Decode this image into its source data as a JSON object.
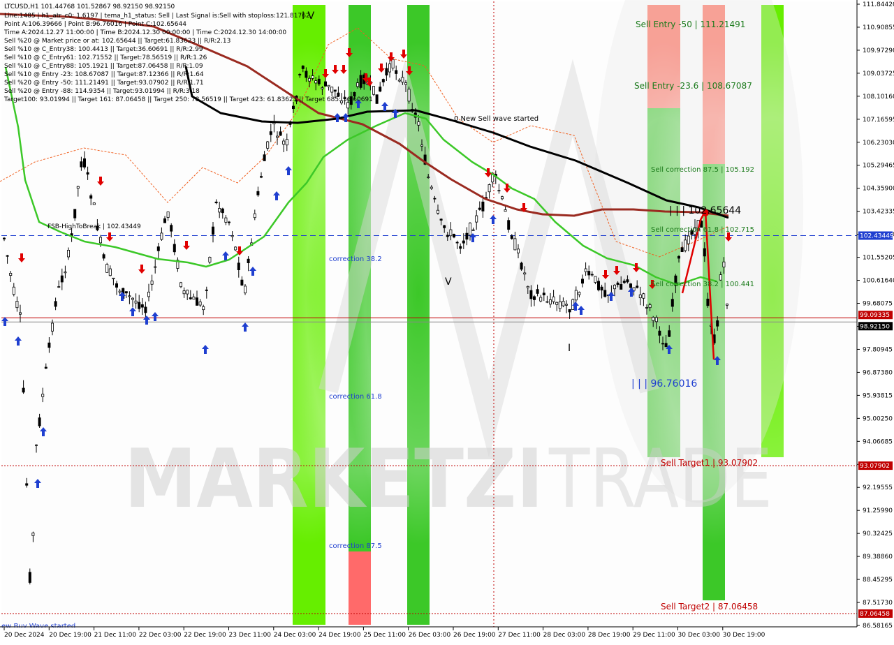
{
  "chart_data": {
    "type": "candlestick",
    "symbol_line": "LTCUSD,H1  101.44768 101.52867 98.92150 98.92150",
    "info_lines": [
      "Line:1485 | h1_atr_c0: 1.6197 | tema_h1_status: Sell | Last Signal is:Sell with stoploss:121.81762",
      "Point A:106.39666 | Point B:96.76016 | Point C:102.65644",
      "Time A:2024.12.27 11:00:00 | Time B:2024.12.30 00:00:00 | Time C:2024.12.30 14:00:00",
      "Sell %20 @ Market price or at: 102.65644 || Target:61.83623 || R/R:2.13",
      "Sell %10 @ C_Entry38: 100.4413 || Target:36.60691 || R/R:2.99",
      "Sell %10 @ C_Entry61: 102.71552 || Target:78.56519 || R/R:1.26",
      "Sell %10 @ C_Entry88: 105.1921 || Target:87.06458 || R/R:1.09",
      "Sell %10 @ Entry -23: 108.67087 || Target:87.12366 || R/R:1.64",
      "Sell %20 @ Entry -50: 111.21491 || Target:93.07902 || R/R:1.71",
      "Sell %20 @ Entry -88: 114.9354 || Target:93.01994 || R/R:3.18",
      "Target100: 93.01994 || Target 161: 87.06458 || Target 250: 78.56519 || Target 423: 61.83623 || Target 685: 36.60691"
    ],
    "y_ticks": [
      "111.84420",
      "110.90855",
      "109.97290",
      "109.03725",
      "108.10160",
      "107.16595",
      "106.23030",
      "105.29465",
      "104.35900",
      "103.42335",
      "102.48770",
      "101.55205",
      "100.61640",
      "99.68075",
      "98.74510",
      "97.80945",
      "96.87380",
      "95.93815",
      "95.00250",
      "94.06685",
      "93.13120",
      "92.19555",
      "91.25990",
      "90.32425",
      "89.38860",
      "88.45295",
      "87.51730",
      "86.58165"
    ],
    "y_range": [
      86.58165,
      111.8442
    ],
    "x_ticks": [
      "20 Dec 2024",
      "20 Dec 19:00",
      "21 Dec 11:00",
      "22 Dec 03:00",
      "22 Dec 19:00",
      "23 Dec 11:00",
      "24 Dec 03:00",
      "24 Dec 19:00",
      "25 Dec 11:00",
      "26 Dec 03:00",
      "26 Dec 19:00",
      "27 Dec 11:00",
      "28 Dec 03:00",
      "28 Dec 19:00",
      "29 Dec 11:00",
      "30 Dec 03:00",
      "30 Dec 19:00"
    ],
    "price_badges": [
      {
        "value": "102.43449",
        "price": 102.43449,
        "bg": "#1f3fd0",
        "fg": "#ffffff"
      },
      {
        "value": "99.09335",
        "price": 99.09335,
        "bg": "#c00000",
        "fg": "#ffffff"
      },
      {
        "value": "98.92150",
        "price": 98.9215,
        "bg": "#000000",
        "fg": "#ffffff"
      },
      {
        "value": "93.07902",
        "price": 93.07902,
        "bg": "#c00000",
        "fg": "#ffffff"
      },
      {
        "value": "87.06458",
        "price": 87.06458,
        "bg": "#c00000",
        "fg": "#ffffff"
      }
    ],
    "horizontal_lines": [
      {
        "price": 102.43449,
        "color": "#1f3fd0",
        "style": "dashed"
      },
      {
        "price": 99.09335,
        "color": "#c00000",
        "style": "solid"
      },
      {
        "price": 98.9215,
        "color": "#888888",
        "style": "solid"
      },
      {
        "price": 93.07902,
        "color": "#c00000",
        "style": "dotted"
      },
      {
        "price": 87.06458,
        "color": "#c00000",
        "style": "dotted"
      }
    ],
    "labels": {
      "fsb": "FSB-HighToBreak | 102.43449",
      "corr382": "correction 38.2",
      "corr618": "correction 61.8",
      "corr875": "correction 87.5",
      "new_wave": "0 New Sell wave started",
      "sell_entry_50": "Sell Entry -50 | 111.21491",
      "sell_entry_236": "Sell Entry -23.6 | 108.67087",
      "sell_corr_875": "Sell correction 87.5 | 105.192",
      "sell_corr_618": "Sell correction 61.8 | 102.715",
      "sell_corr_382": "Sell correction 38.2 | 100.441",
      "point_c": "| | | 102.65644",
      "point_b": "| | | 96.76016",
      "target1": "Sell Target1 | 93.07902",
      "target2": "Sell Target2 | 87.06458",
      "wave_iv": "I V",
      "wave_v": "V",
      "wave_i": "I",
      "buy_wave": "ew Buy Wave started",
      "watermark_a": "MARKETZI",
      "watermark_b": "TRADE"
    },
    "zones": [
      {
        "start": 419,
        "end": 466,
        "bands": [
          {
            "from": 7,
            "to": 895,
            "color": "#66ee00"
          }
        ]
      },
      {
        "start": 499,
        "end": 531,
        "bands": [
          {
            "from": 7,
            "to": 790,
            "color": "#3cc828"
          },
          {
            "from": 790,
            "to": 895,
            "color": "#ff6a6a"
          }
        ]
      },
      {
        "start": 583,
        "end": 615,
        "bands": [
          {
            "from": 7,
            "to": 895,
            "color": "#3cc828"
          }
        ]
      },
      {
        "start": 927,
        "end": 974,
        "bands": [
          {
            "from": 7,
            "to": 155,
            "color": "#ff7b6b"
          },
          {
            "from": 155,
            "to": 655,
            "color": "#3cc828"
          }
        ]
      },
      {
        "start": 1006,
        "end": 1038,
        "bands": [
          {
            "from": 7,
            "to": 235,
            "color": "#ff7b6b"
          },
          {
            "from": 235,
            "to": 860,
            "color": "#3cc828"
          }
        ]
      },
      {
        "start": 1090,
        "end": 1122,
        "bands": [
          {
            "from": 7,
            "to": 655,
            "color": "#66ee00"
          }
        ]
      }
    ],
    "ma_black": [
      [
        266,
        95
      ],
      [
        275,
        138
      ],
      [
        316,
        162
      ],
      [
        375,
        174
      ],
      [
        426,
        176
      ],
      [
        483,
        170
      ],
      [
        526,
        160
      ],
      [
        595,
        158
      ],
      [
        646,
        172
      ],
      [
        706,
        190
      ],
      [
        759,
        210
      ],
      [
        824,
        230
      ],
      [
        899,
        262
      ],
      [
        954,
        287
      ],
      [
        1000,
        297
      ],
      [
        1043,
        312
      ]
    ],
    "ma_darkred": [
      [
        0,
        20
      ],
      [
        96,
        24
      ],
      [
        162,
        30
      ],
      [
        220,
        38
      ],
      [
        289,
        67
      ],
      [
        354,
        95
      ],
      [
        415,
        135
      ],
      [
        456,
        162
      ],
      [
        519,
        178
      ],
      [
        572,
        206
      ],
      [
        605,
        230
      ],
      [
        646,
        257
      ],
      [
        695,
        285
      ],
      [
        740,
        300
      ],
      [
        777,
        307
      ],
      [
        822,
        309
      ],
      [
        862,
        300
      ],
      [
        907,
        300
      ],
      [
        952,
        303
      ],
      [
        1000,
        304
      ],
      [
        1043,
        309
      ]
    ],
    "ma_green": [
      [
        8,
        96
      ],
      [
        26,
        182
      ],
      [
        36,
        258
      ],
      [
        56,
        318
      ],
      [
        86,
        332
      ],
      [
        121,
        346
      ],
      [
        165,
        354
      ],
      [
        226,
        371
      ],
      [
        269,
        376
      ],
      [
        295,
        382
      ],
      [
        328,
        372
      ],
      [
        378,
        339
      ],
      [
        413,
        290
      ],
      [
        439,
        262
      ],
      [
        463,
        225
      ],
      [
        498,
        200
      ],
      [
        539,
        180
      ],
      [
        580,
        162
      ],
      [
        610,
        170
      ],
      [
        635,
        200
      ],
      [
        676,
        232
      ],
      [
        706,
        250
      ],
      [
        733,
        270
      ],
      [
        765,
        285
      ],
      [
        795,
        318
      ],
      [
        835,
        352
      ],
      [
        869,
        370
      ],
      [
        908,
        380
      ],
      [
        939,
        397
      ],
      [
        970,
        408
      ],
      [
        1003,
        397
      ],
      [
        1026,
        403
      ]
    ],
    "volatility_band": [
      [
        0,
        260
      ],
      [
        50,
        232
      ],
      [
        120,
        212
      ],
      [
        180,
        222
      ],
      [
        240,
        290
      ],
      [
        290,
        240
      ],
      [
        340,
        262
      ],
      [
        380,
        224
      ],
      [
        424,
        162
      ],
      [
        470,
        64
      ],
      [
        512,
        40
      ],
      [
        560,
        84
      ],
      [
        608,
        94
      ],
      [
        656,
        170
      ],
      [
        706,
        204
      ],
      [
        760,
        180
      ],
      [
        822,
        194
      ],
      [
        882,
        346
      ],
      [
        944,
        368
      ],
      [
        1000,
        344
      ],
      [
        1043,
        324
      ]
    ],
    "wedge_line": [
      [
        977,
        420
      ],
      [
        1003,
        315
      ],
      [
        1010,
        302
      ],
      [
        1022,
        515
      ]
    ]
  }
}
